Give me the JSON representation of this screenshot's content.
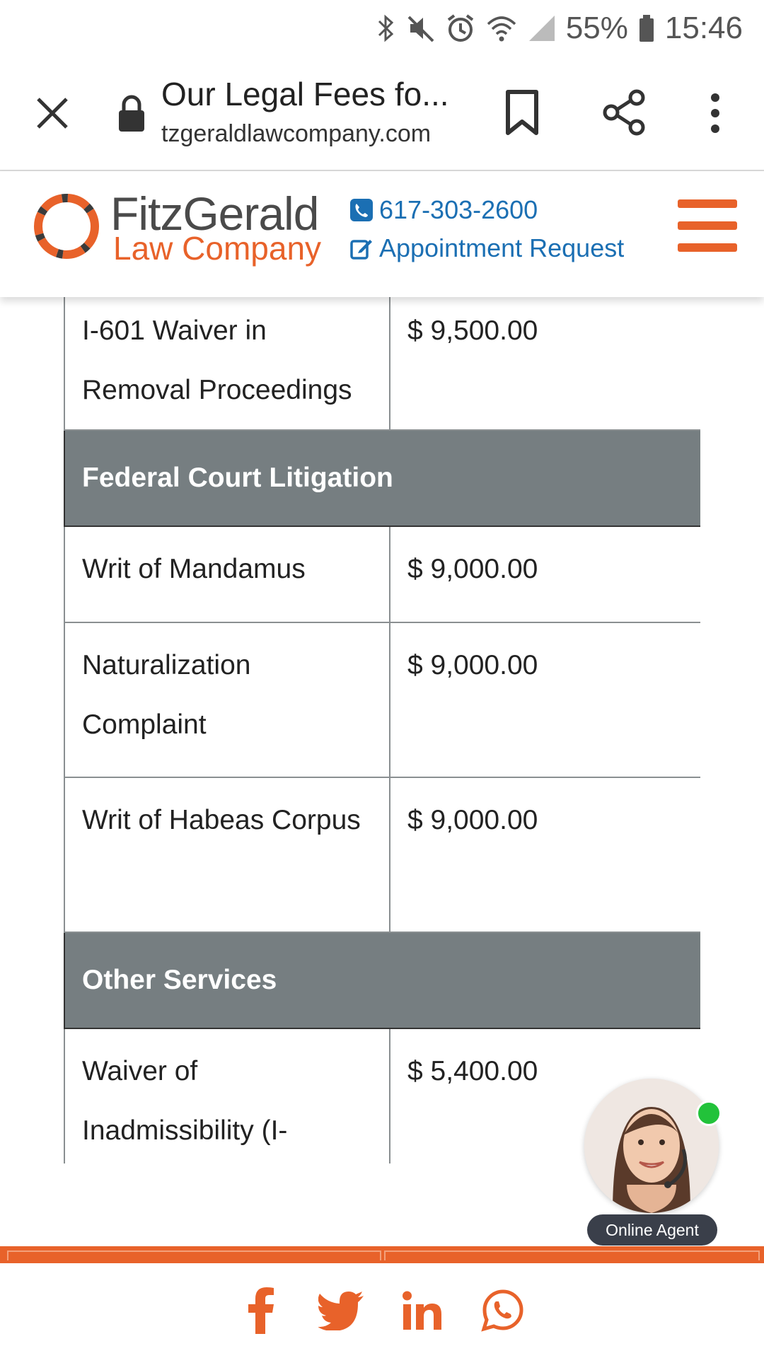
{
  "status_bar": {
    "battery": "55%",
    "time": "15:46",
    "icons": [
      "bluetooth-icon",
      "mute-icon",
      "alarm-icon",
      "wifi-icon",
      "signal-icon",
      "battery-icon"
    ]
  },
  "browser": {
    "page_title": "Our Legal Fees fo...",
    "url": "tzgeraldlawcompany.com",
    "icons": [
      "close-icon",
      "lock-icon",
      "bookmark-icon",
      "share-icon",
      "more-icon"
    ]
  },
  "site_header": {
    "logo_line1": "FitzGerald",
    "logo_line2": "Law Company",
    "phone": "617-303-2600",
    "appointment": "Appointment Request",
    "colors": {
      "brand": "#e8622a",
      "link": "#1b6fb3"
    }
  },
  "table": {
    "rows": [
      {
        "service": "I-601 Waiver in Removal Proceedings",
        "fee": "$ 9,500.00"
      }
    ],
    "section1": "Federal Court Litigation",
    "section1_rows": [
      {
        "service": "Writ of Mandamus",
        "fee": "$ 9,000.00"
      },
      {
        "service": "Naturalization Complaint",
        "fee": "$ 9,000.00"
      },
      {
        "service": "Writ of Habeas Corpus",
        "fee": "$ 9,000.00"
      }
    ],
    "section2": "Other Services",
    "section2_rows": [
      {
        "service": "Waiver of Inadmissibility (I-",
        "fee": "$ 5,400.00"
      }
    ],
    "colors": {
      "section_bg": "#767e81"
    }
  },
  "agent": {
    "label": "Online Agent",
    "status_color": "#22c23a"
  },
  "footer": {
    "social": [
      "facebook-icon",
      "twitter-icon",
      "linkedin-icon",
      "whatsapp-icon"
    ]
  }
}
